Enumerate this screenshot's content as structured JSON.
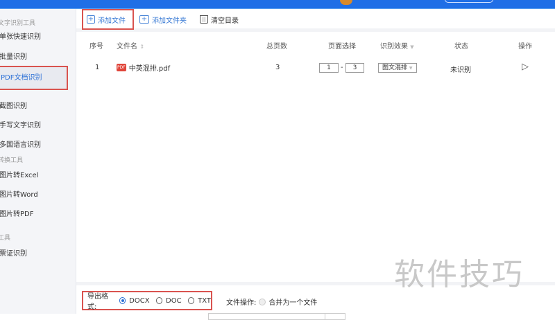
{
  "sidebar": {
    "sections": [
      "文字识别工具",
      "转换工具",
      "工具"
    ],
    "items": [
      "单张快速识别",
      "批量识别",
      "PDF文档识别",
      "截图识别",
      "手写文字识别",
      "多国语言识别",
      "图片转Excel",
      "图片转Word",
      "图片转PDF",
      "票证识别"
    ]
  },
  "toolbar": {
    "add_file": "添加文件",
    "add_folder": "添加文件夹",
    "clear": "清空目录"
  },
  "table": {
    "headers": [
      "序号",
      "文件名",
      "总页数",
      "页面选择",
      "识别效果",
      "状态",
      "操作"
    ],
    "rows": [
      {
        "index": "1",
        "name": "中英混排.pdf",
        "pages": "3",
        "from": "1",
        "to": "3",
        "effect": "图文混排",
        "status": "未识别"
      }
    ]
  },
  "footer": {
    "format_label": "导出格式:",
    "formats": [
      "DOCX",
      "DOC",
      "TXT"
    ],
    "selected": "DOCX",
    "file_op_label": "文件操作:",
    "merge": "合并为一个文件"
  },
  "watermark": "软件技巧"
}
